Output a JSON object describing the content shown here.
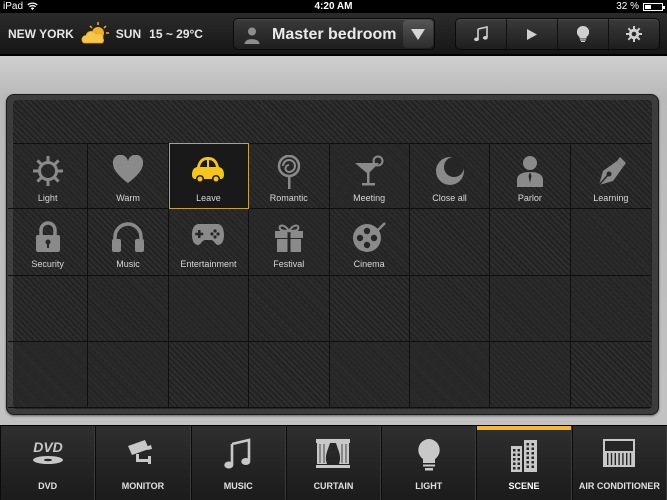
{
  "status": {
    "device": "iPad",
    "time": "4:20 AM",
    "battery": "32 %",
    "battery_level": 0.32
  },
  "header": {
    "city": "NEW YORK",
    "day": "SUN",
    "temperature": "15 ~ 29°C",
    "room": "Master bedroom",
    "top_buttons": [
      {
        "icon": "music-note-icon"
      },
      {
        "icon": "play-icon"
      },
      {
        "icon": "bulb-icon"
      },
      {
        "icon": "gear-icon"
      }
    ]
  },
  "scenes": [
    {
      "label": "Light",
      "icon": "sun-icon"
    },
    {
      "label": "Warm",
      "icon": "heart-icon"
    },
    {
      "label": "Leave",
      "icon": "car-icon",
      "active": true
    },
    {
      "label": "Romantic",
      "icon": "lollipop-icon"
    },
    {
      "label": "Meeting",
      "icon": "cocktail-icon"
    },
    {
      "label": "Close all",
      "icon": "moon-icon"
    },
    {
      "label": "Parlor",
      "icon": "person-icon"
    },
    {
      "label": "Learning",
      "icon": "pen-icon"
    },
    {
      "label": "Security",
      "icon": "lock-icon"
    },
    {
      "label": "Music",
      "icon": "headphones-icon"
    },
    {
      "label": "Entertainment",
      "icon": "gamepad-icon"
    },
    {
      "label": "Festival",
      "icon": "gift-icon"
    },
    {
      "label": "Cinema",
      "icon": "film-reel-icon"
    }
  ],
  "nav": [
    {
      "label": "DVD",
      "icon": "dvd-icon"
    },
    {
      "label": "MONITOR",
      "icon": "camera-icon"
    },
    {
      "label": "MUSIC",
      "icon": "music-note-icon"
    },
    {
      "label": "CURTAIN",
      "icon": "curtain-icon"
    },
    {
      "label": "LIGHT",
      "icon": "bulb-icon"
    },
    {
      "label": "SCENE",
      "icon": "building-icon",
      "active": true
    },
    {
      "label": "AIR CONDITIONER",
      "icon": "air-conditioner-icon"
    }
  ],
  "colors": {
    "accent": "#f5b731",
    "active_icon": "#f5c518",
    "icon": "#8a8a8a"
  }
}
